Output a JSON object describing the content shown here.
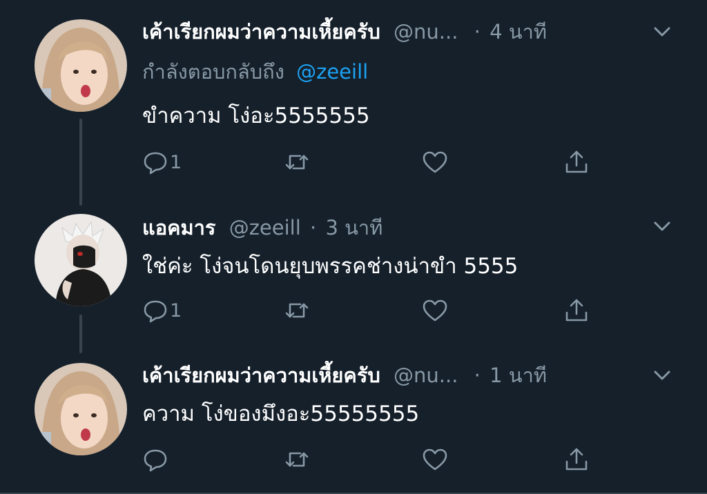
{
  "colors": {
    "background": "#15202b",
    "text": "#ffffff",
    "secondary": "#8899a6",
    "link": "#1da1f2",
    "line": "#38444d"
  },
  "tweets": [
    {
      "name": "เค้าเรียกผมว่าความเหี้ยครับ",
      "handle": "@nu...",
      "separator": "·",
      "time": "4 นาที",
      "reply_prefix": "กำลังตอบกลับถึง",
      "reply_handle": "@zeeill",
      "text": "ขำความ โง่อะ5555555",
      "reply_count": "1",
      "avatar_icon": "user-avatar-photo"
    },
    {
      "name": "แอคมาร",
      "handle": "@zeeill",
      "separator": "·",
      "time": "3 นาที",
      "text": "ใช่ค่ะ โง่จนโดนยุบพรรคช่างน่าขำ 5555",
      "reply_count": "1",
      "avatar_icon": "masked-character-avatar"
    },
    {
      "name": "เค้าเรียกผมว่าความเหี้ยครับ",
      "handle": "@nu...",
      "separator": "·",
      "time": "1 นาที",
      "text": "ความ โง่ของมึงอะ55555555",
      "reply_count": "",
      "avatar_icon": "user-avatar-photo"
    }
  ]
}
